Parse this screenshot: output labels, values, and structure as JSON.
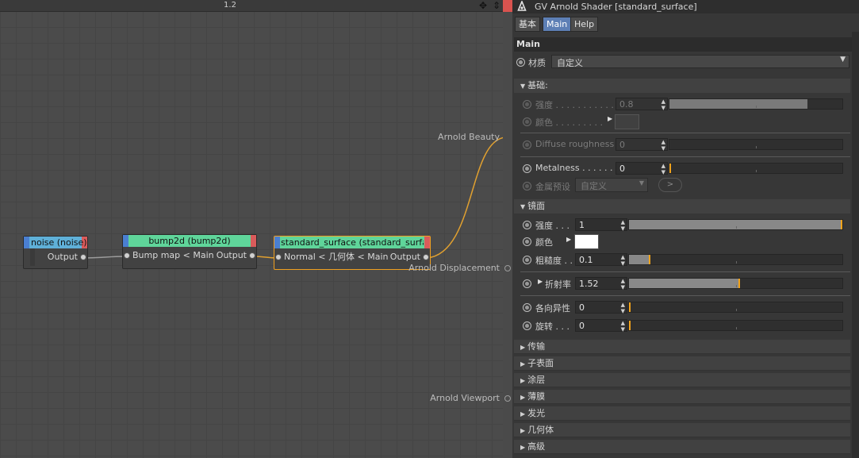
{
  "editor": {
    "zoom": "1.2",
    "nodes": {
      "noise": {
        "title": "noise (noise)",
        "output": "Output",
        "left_color": "#4a7fd1",
        "right_color": "#d95b5b"
      },
      "bump": {
        "title": "bump2d (bump2d)",
        "input": "Bump map < Main",
        "output": "Output",
        "header_color": "#5fd59a"
      },
      "surface": {
        "title": "standard_surface (standard_surface",
        "input": "Normal < 几何体 < Main",
        "output": "Output",
        "header_color": "#5fd59a"
      }
    },
    "outputs": {
      "beauty": "Arnold Beauty",
      "displacement": "Arnold Displacement",
      "viewport": "Arnold Viewport"
    },
    "wire_color": "#e0a030"
  },
  "panel": {
    "title": "GV Arnold Shader [standard_surface]",
    "tabs": [
      "基本",
      "Main",
      "Help"
    ],
    "section": "Main",
    "material": {
      "label": "材质",
      "value": "自定义"
    },
    "base": {
      "header": "基础:",
      "strength": {
        "label": "强度",
        "value": "0.8",
        "level": 0.8
      },
      "color": {
        "label": "颜色"
      },
      "diffuse_roughness": {
        "label": "Diffuse roughness",
        "value": "0"
      },
      "metalness": {
        "label": "Metalness",
        "value": "0"
      },
      "metal_preset": {
        "label": "金属预设",
        "value": "自定义",
        "button": ">"
      }
    },
    "specular": {
      "header": "镜面",
      "strength": {
        "label": "强度",
        "value": "1",
        "level": 1.0
      },
      "color": {
        "label": "颜色",
        "swatch": "#ffffff"
      },
      "roughness": {
        "label": "粗糙度",
        "value": "0.1",
        "level": 0.1
      },
      "ior": {
        "label": "折射率",
        "value": "1.52",
        "level": 0.52
      },
      "anisotropy": {
        "label": "各向异性",
        "value": "0",
        "level": 0
      },
      "rotation": {
        "label": "旋转",
        "value": "0",
        "level": 0
      }
    },
    "collapsed_sections": [
      "传输",
      "子表面",
      "涂层",
      "薄膜",
      "发光",
      "几何体",
      "高级"
    ]
  }
}
